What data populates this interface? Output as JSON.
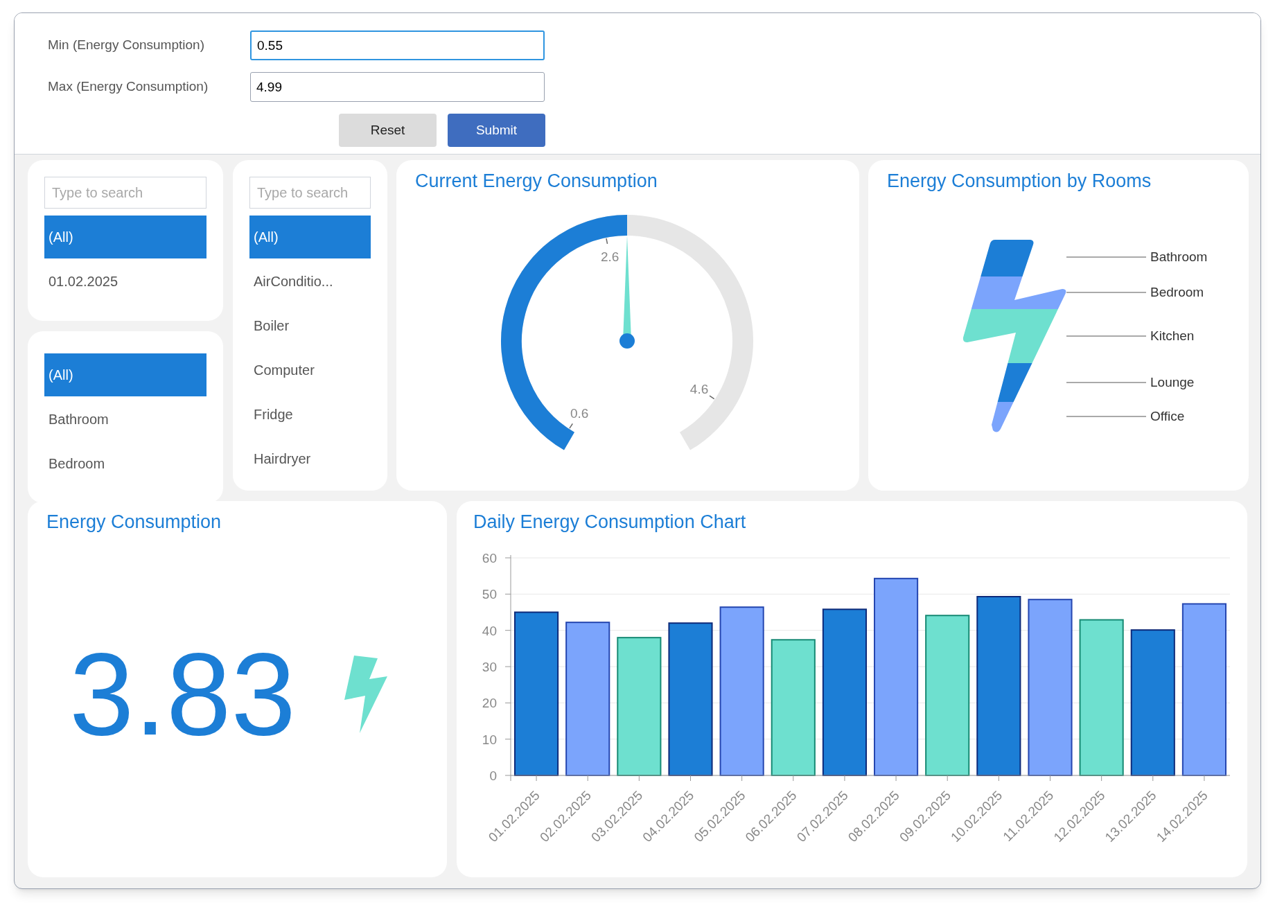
{
  "filter_form": {
    "fields": [
      {
        "label": "Min (Energy Consumption)",
        "value": "0.55",
        "focused": true
      },
      {
        "label": "Max (Energy Consumption)",
        "value": "4.99",
        "focused": false
      }
    ],
    "buttons": [
      {
        "label": "Reset",
        "kind": "secondary"
      },
      {
        "label": "Submit",
        "kind": "primary"
      }
    ]
  },
  "date_filter": {
    "search": {
      "placeholder": "Type to search"
    },
    "items": [
      {
        "label": "(All)",
        "selected": true
      },
      {
        "label": "01.02.2025",
        "selected": false
      }
    ]
  },
  "room_filter": {
    "items": [
      {
        "label": "(All)",
        "selected": true
      },
      {
        "label": "Bathroom",
        "selected": false
      },
      {
        "label": "Bedroom",
        "selected": false
      }
    ]
  },
  "device_filter": {
    "search": {
      "placeholder": "Type to search"
    },
    "items": [
      {
        "label": "(All)",
        "selected": true
      },
      {
        "label": "AirConditio...",
        "selected": false
      },
      {
        "label": "Boiler",
        "selected": false
      },
      {
        "label": "Computer",
        "selected": false
      },
      {
        "label": "Fridge",
        "selected": false
      },
      {
        "label": "Hairdryer",
        "selected": false
      }
    ]
  },
  "gauge": {
    "title": "Current Energy Consumption",
    "level": 0.5,
    "ticks": [
      "0.6",
      "2.6",
      "4.6"
    ]
  },
  "rooms_chart": {
    "title": "Energy Consumption by Rooms",
    "rooms": [
      {
        "label": "Bathroom",
        "color": "#1c7ed6"
      },
      {
        "label": "Bedroom",
        "color": "#7ba4fc"
      },
      {
        "label": "Kitchen",
        "color": "#6ee0cf"
      },
      {
        "label": "Lounge",
        "color": "#1c7ed6"
      },
      {
        "label": "Office",
        "color": "#7ba4fc"
      }
    ]
  },
  "kpi": {
    "title": "Energy Consumption",
    "value": "3.83"
  },
  "daily_chart": {
    "title": "Daily Energy Consumption Chart",
    "chart_data": {
      "type": "bar",
      "categories": [
        "01.02.2025",
        "02.02.2025",
        "03.02.2025",
        "04.02.2025",
        "05.02.2025",
        "06.02.2025",
        "07.02.2025",
        "08.02.2025",
        "09.02.2025",
        "10.02.2025",
        "11.02.2025",
        "12.02.2025",
        "13.02.2025",
        "14.02.2025"
      ],
      "series": [
        {
          "color": "#1c7ed6",
          "values": [
            45,
            null,
            null,
            42,
            null,
            null,
            45.8,
            null,
            null,
            49.3,
            null,
            null,
            40.1,
            null
          ]
        },
        {
          "color": "#7ba4fc",
          "values": [
            null,
            42.2,
            null,
            null,
            46.4,
            null,
            null,
            54.3,
            null,
            null,
            48.5,
            null,
            null,
            47.3
          ]
        },
        {
          "color": "#6ee0cf",
          "values": [
            null,
            null,
            38,
            null,
            null,
            37.4,
            null,
            null,
            44.1,
            null,
            null,
            42.9,
            null,
            null
          ]
        }
      ],
      "ylim": [
        0,
        60
      ],
      "yticks": [
        0,
        10,
        20,
        30,
        40,
        50,
        60
      ],
      "grid": true
    }
  }
}
